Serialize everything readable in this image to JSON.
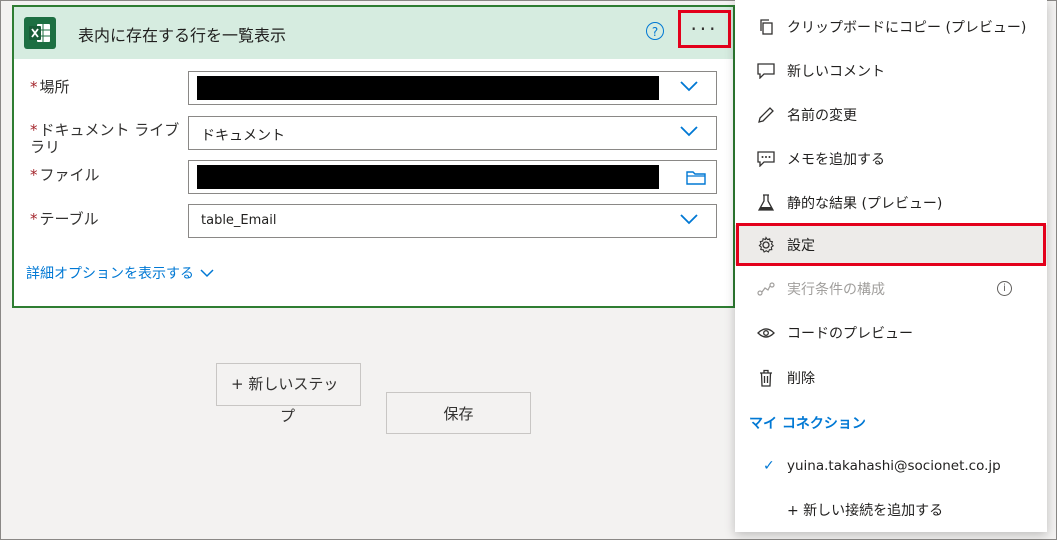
{
  "action": {
    "title": "表内に存在する行を一覧表示",
    "help_glyph": "?",
    "more_glyph": "···",
    "fields": [
      {
        "label": "場所",
        "value": "",
        "redacted": true,
        "control": "dropdown"
      },
      {
        "label_line1": "ドキュメント ライブ",
        "label_line2": "ラリ",
        "value": "ドキュメント",
        "control": "dropdown"
      },
      {
        "label": "ファイル",
        "value": "",
        "redacted": true,
        "control": "file-picker"
      },
      {
        "label": "テーブル",
        "value": "table_Email",
        "control": "dropdown"
      }
    ],
    "required_mark": "*",
    "advanced_link": "詳細オプションを表示する"
  },
  "buttons": {
    "new_step_line1": "+ 新しいステッ",
    "new_step_line2": "プ",
    "save": "保存"
  },
  "menu": {
    "items": [
      {
        "label": "クリップボードにコピー (プレビュー)",
        "icon": "copy-icon"
      },
      {
        "label": "新しいコメント",
        "icon": "comment-icon"
      },
      {
        "label": "名前の変更",
        "icon": "pencil-icon"
      },
      {
        "label": "メモを追加する",
        "icon": "note-icon"
      },
      {
        "label": "静的な結果 (プレビュー)",
        "icon": "flask-icon"
      },
      {
        "label": "設定",
        "icon": "gear-icon"
      },
      {
        "label": "実行条件の構成",
        "icon": "run-after-icon",
        "disabled": true
      },
      {
        "label": "コードのプレビュー",
        "icon": "eye-icon"
      },
      {
        "label": "削除",
        "icon": "trash-icon"
      }
    ],
    "connections_title": "マイ コネクション",
    "connection": "yuina.takahashi@socionet.co.jp",
    "add_connection": "+ 新しい接続を追加する"
  },
  "colors": {
    "accent": "#0078d4",
    "excel_green": "#1d6f42",
    "header_bg": "#d6ece0",
    "highlight_red": "#e3001b"
  }
}
